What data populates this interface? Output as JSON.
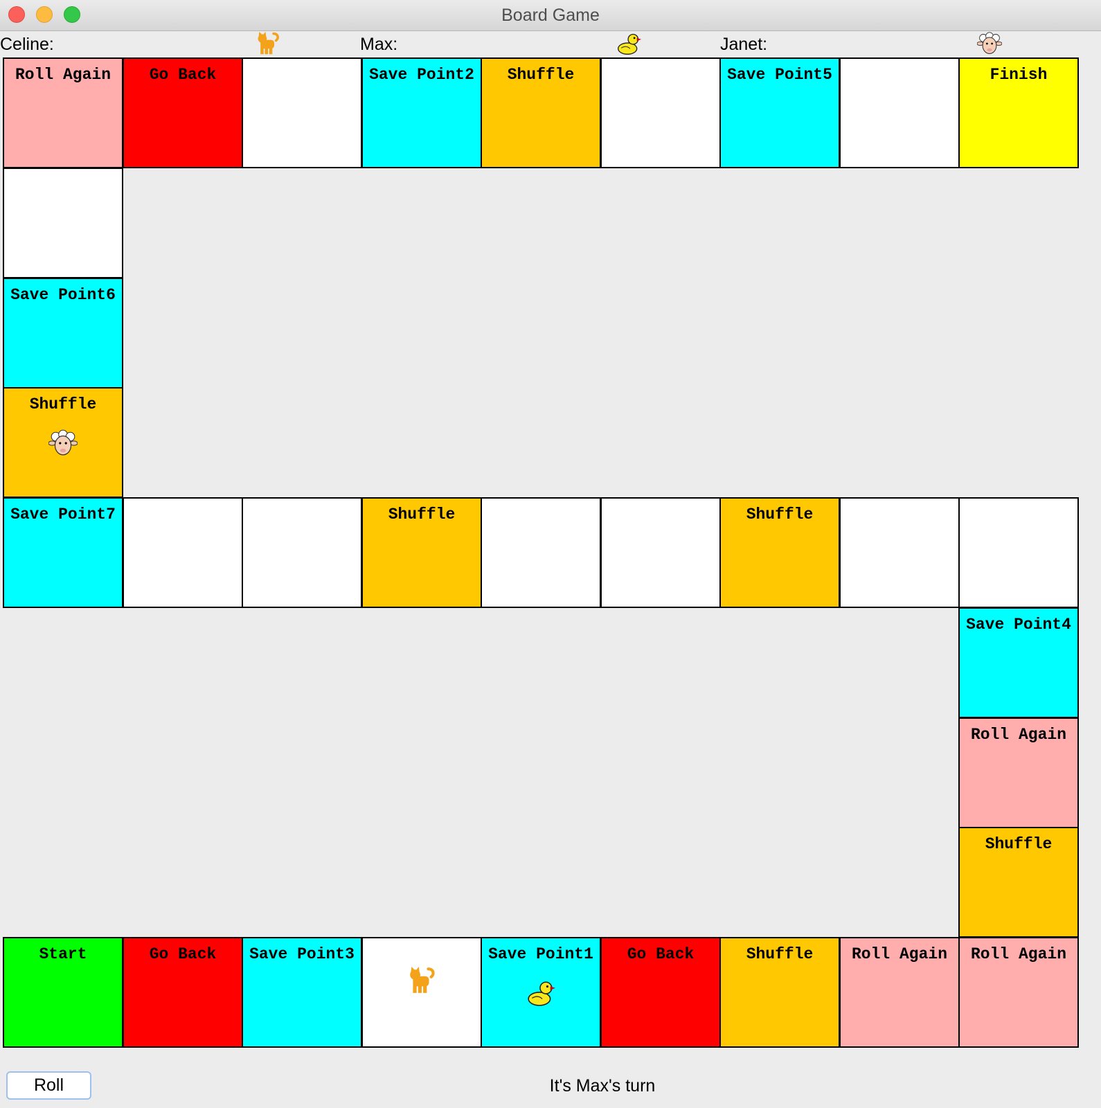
{
  "window": {
    "title": "Board Game"
  },
  "players": [
    {
      "name": "Celine:",
      "token": "cat"
    },
    {
      "name": "Max:",
      "token": "duck"
    },
    {
      "name": "Janet:",
      "token": "sheep"
    }
  ],
  "colors": {
    "roll_again": "#ffadad",
    "go_back": "#ff0000",
    "blank": "#ffffff",
    "save_point": "#00ffff",
    "shuffle": "#ffc800",
    "finish": "#ffff00",
    "start": "#00ff00"
  },
  "tiles": [
    {
      "row": 0,
      "col": 0,
      "type": "roll_again",
      "label": "Roll Again"
    },
    {
      "row": 0,
      "col": 1,
      "type": "go_back",
      "label": "Go Back"
    },
    {
      "row": 0,
      "col": 2,
      "type": "blank",
      "label": ""
    },
    {
      "row": 0,
      "col": 3,
      "type": "save_point",
      "label": "Save Point2"
    },
    {
      "row": 0,
      "col": 4,
      "type": "shuffle",
      "label": "Shuffle"
    },
    {
      "row": 0,
      "col": 5,
      "type": "blank",
      "label": ""
    },
    {
      "row": 0,
      "col": 6,
      "type": "save_point",
      "label": "Save Point5"
    },
    {
      "row": 0,
      "col": 7,
      "type": "blank",
      "label": ""
    },
    {
      "row": 0,
      "col": 8,
      "type": "finish",
      "label": "Finish"
    },
    {
      "row": 1,
      "col": 0,
      "type": "blank",
      "label": ""
    },
    {
      "row": 2,
      "col": 0,
      "type": "save_point",
      "label": "Save Point6"
    },
    {
      "row": 3,
      "col": 0,
      "type": "shuffle",
      "label": "Shuffle",
      "tokens": [
        "sheep"
      ]
    },
    {
      "row": 4,
      "col": 0,
      "type": "save_point",
      "label": "Save Point7"
    },
    {
      "row": 4,
      "col": 1,
      "type": "blank",
      "label": ""
    },
    {
      "row": 4,
      "col": 2,
      "type": "blank",
      "label": ""
    },
    {
      "row": 4,
      "col": 3,
      "type": "shuffle",
      "label": "Shuffle"
    },
    {
      "row": 4,
      "col": 4,
      "type": "blank",
      "label": ""
    },
    {
      "row": 4,
      "col": 5,
      "type": "blank",
      "label": ""
    },
    {
      "row": 4,
      "col": 6,
      "type": "shuffle",
      "label": "Shuffle"
    },
    {
      "row": 4,
      "col": 7,
      "type": "blank",
      "label": ""
    },
    {
      "row": 4,
      "col": 8,
      "type": "blank",
      "label": ""
    },
    {
      "row": 5,
      "col": 8,
      "type": "save_point",
      "label": "Save Point4"
    },
    {
      "row": 6,
      "col": 8,
      "type": "roll_again",
      "label": "Roll Again"
    },
    {
      "row": 7,
      "col": 8,
      "type": "shuffle",
      "label": "Shuffle"
    },
    {
      "row": 8,
      "col": 0,
      "type": "start",
      "label": "Start"
    },
    {
      "row": 8,
      "col": 1,
      "type": "go_back",
      "label": "Go Back"
    },
    {
      "row": 8,
      "col": 2,
      "type": "save_point",
      "label": "Save Point3"
    },
    {
      "row": 8,
      "col": 3,
      "type": "blank",
      "label": "",
      "tokens": [
        "cat"
      ]
    },
    {
      "row": 8,
      "col": 4,
      "type": "save_point",
      "label": "Save Point1",
      "tokens": [
        "duck"
      ]
    },
    {
      "row": 8,
      "col": 5,
      "type": "go_back",
      "label": "Go Back"
    },
    {
      "row": 8,
      "col": 6,
      "type": "shuffle",
      "label": "Shuffle"
    },
    {
      "row": 8,
      "col": 7,
      "type": "roll_again",
      "label": "Roll Again"
    },
    {
      "row": 8,
      "col": 8,
      "type": "roll_again",
      "label": "Roll Again"
    }
  ],
  "controls": {
    "roll_label": "Roll"
  },
  "status": {
    "text": "It's Max's turn"
  }
}
